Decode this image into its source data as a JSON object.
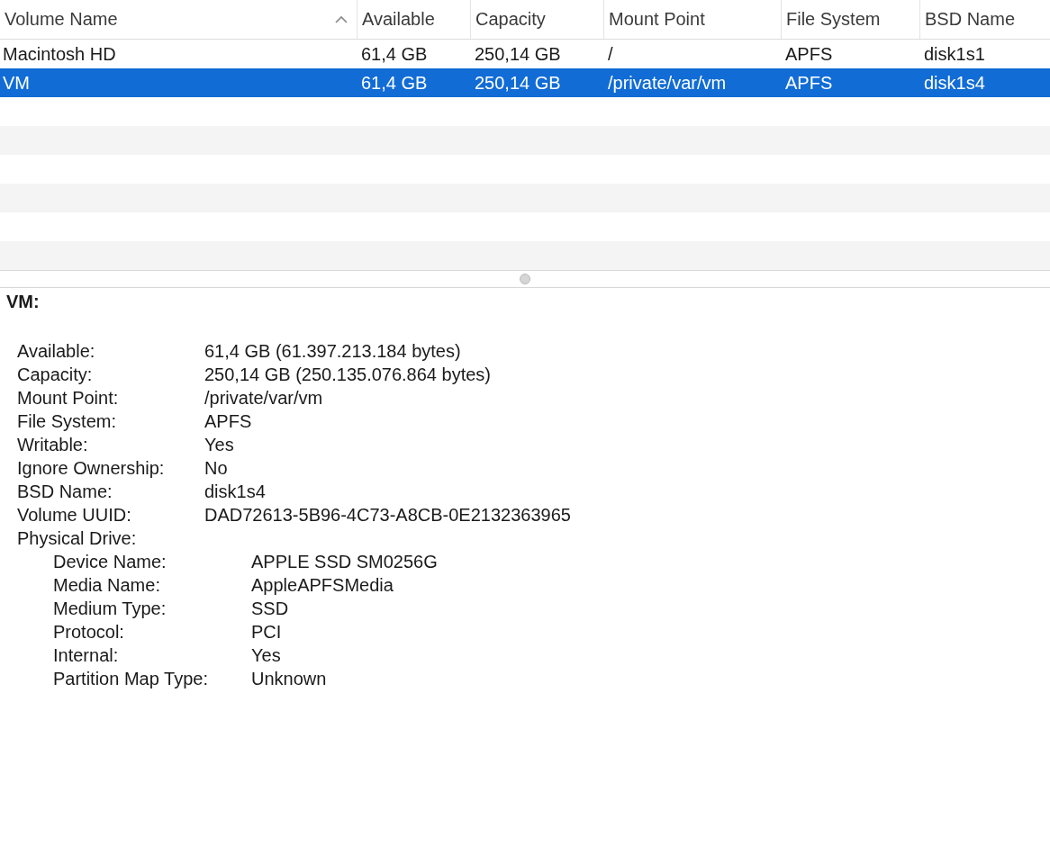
{
  "table": {
    "columns": [
      {
        "label": "Volume Name",
        "sorted": true
      },
      {
        "label": "Available",
        "sorted": false
      },
      {
        "label": "Capacity",
        "sorted": false
      },
      {
        "label": "Mount Point",
        "sorted": false
      },
      {
        "label": "File System",
        "sorted": false
      },
      {
        "label": "BSD Name",
        "sorted": false
      }
    ],
    "rows": [
      {
        "cells": [
          "Macintosh HD",
          "61,4 GB",
          "250,14 GB",
          "/",
          "APFS",
          "disk1s1"
        ],
        "selected": false
      },
      {
        "cells": [
          "VM",
          "61,4 GB",
          "250,14 GB",
          "/private/var/vm",
          "APFS",
          "disk1s4"
        ],
        "selected": true
      }
    ]
  },
  "details": {
    "title": "VM:",
    "fields": [
      {
        "label": "Available:",
        "value": "61,4 GB (61.397.213.184 bytes)"
      },
      {
        "label": "Capacity:",
        "value": "250,14 GB (250.135.076.864 bytes)"
      },
      {
        "label": "Mount Point:",
        "value": "/private/var/vm"
      },
      {
        "label": "File System:",
        "value": "APFS"
      },
      {
        "label": "Writable:",
        "value": "Yes"
      },
      {
        "label": "Ignore Ownership:",
        "value": "No"
      },
      {
        "label": "BSD Name:",
        "value": "disk1s4"
      },
      {
        "label": "Volume UUID:",
        "value": "DAD72613-5B96-4C73-A8CB-0E2132363965"
      },
      {
        "label": "Physical Drive:",
        "children": [
          {
            "label": "Device Name:",
            "value": "APPLE SSD SM0256G"
          },
          {
            "label": "Media Name:",
            "value": "AppleAPFSMedia"
          },
          {
            "label": "Medium Type:",
            "value": "SSD"
          },
          {
            "label": "Protocol:",
            "value": "PCI"
          },
          {
            "label": "Internal:",
            "value": "Yes"
          },
          {
            "label": "Partition Map Type:",
            "value": "Unknown"
          }
        ]
      }
    ]
  }
}
